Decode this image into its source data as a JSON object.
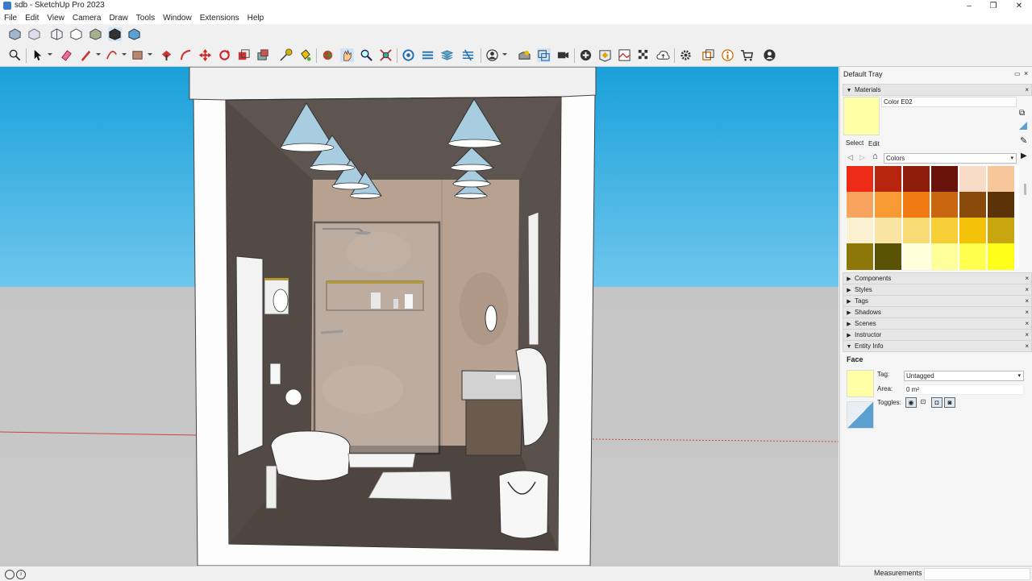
{
  "window": {
    "title": "sdb - SketchUp Pro 2023",
    "minimize": "–",
    "maximize": "❐",
    "close": "✕"
  },
  "menu": [
    "File",
    "Edit",
    "View",
    "Camera",
    "Draw",
    "Tools",
    "Window",
    "Extensions",
    "Help"
  ],
  "tray": {
    "title": "Default Tray",
    "materials": {
      "header": "Materials",
      "current_name": "Color E02",
      "current_color": "#ffffa6",
      "tab_select": "Select",
      "tab_edit": "Edit",
      "library": "Colors",
      "swatches": [
        "#ee2b17",
        "#b8250e",
        "#8f1d0c",
        "#6a130a",
        "#f8dcc8",
        "#f7c69b",
        "#f9a45e",
        "#f79a33",
        "#f27a12",
        "#c96710",
        "#8a4a0b",
        "#5c3309",
        "#fbf0cf",
        "#f9e4a4",
        "#f7da73",
        "#f5cf35",
        "#f5c20a",
        "#c9a510",
        "#8c7708",
        "#5a5205",
        "#ffffd9",
        "#ffff99",
        "#ffff4d",
        "#ffff1a"
      ]
    },
    "sections": [
      "Components",
      "Styles",
      "Tags",
      "Shadows",
      "Scenes",
      "Instructor"
    ],
    "entity_info": {
      "header": "Entity Info",
      "type": "Face",
      "tag_label": "Tag:",
      "tag_value": "Untagged",
      "area_label": "Area:",
      "area_value": "0 m²",
      "toggles_label": "Toggles:"
    }
  },
  "status": {
    "measurements_label": "Measurements",
    "info_icon": "i"
  }
}
